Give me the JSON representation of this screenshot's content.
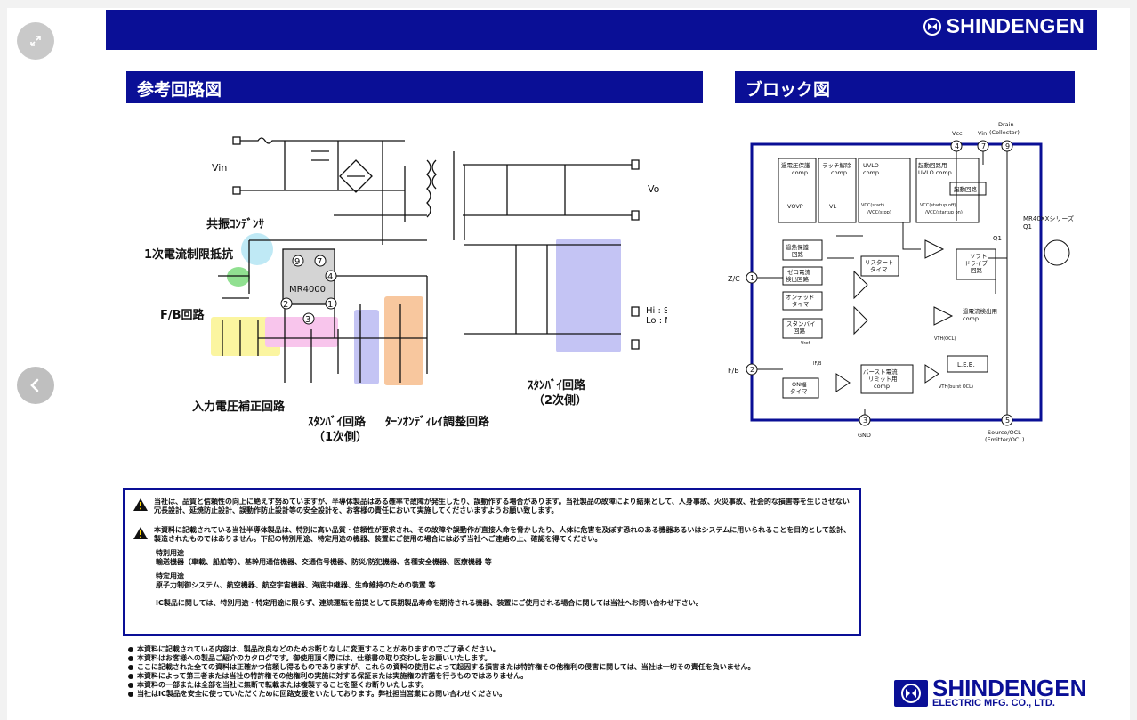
{
  "brand": {
    "top_logo": "SHINDENGEN",
    "foot_name": "SHINDENGEN",
    "foot_sub": "ELECTRIC MFG. CO., LTD."
  },
  "sections": {
    "circuit_title": "参考回路図",
    "block_title": "ブロック図"
  },
  "circuit": {
    "vin": "Vin",
    "vo": "Vo",
    "ic": "MR4000",
    "hi": "Hi : Stand-by",
    "lo": "Lo : Normal",
    "labels": {
      "resonant_cap": "共振ｺﾝﾃﾞﾝｻ",
      "primary_limit": "1次電流制限抵抗",
      "fb": "F/B回路",
      "input_comp": "入力電圧補正回路",
      "standby_1": "ｽﾀﾝﾊﾞｲ回路",
      "standby_1_sub": "（1次側）",
      "turn_on": "ﾀｰﾝｵﾝﾃﾞｨﾚｲ調整回路",
      "standby_2": "ｽﾀﾝﾊﾞｲ回路",
      "standby_2_sub": "（2次側）"
    },
    "pins": [
      "9",
      "7",
      "4",
      "2",
      "3",
      "1"
    ]
  },
  "block": {
    "vcc": "Vcc",
    "vin": "Vin",
    "drain": "Drain",
    "collector": "(Collector)",
    "series": "MR40XXシリーズ",
    "q1": "Q1",
    "zc": "Z/C",
    "fb": "F/B",
    "gnd": "GND",
    "source": "Source/OCL",
    "emitter": "(Emitter/OCL)",
    "pins": [
      "4",
      "7",
      "9",
      "1",
      "2",
      "3",
      "5"
    ],
    "comp_overvolt": "過電圧保護",
    "comp_overvolt2": "comp",
    "comp_latch": "ラッチ解除",
    "comp_latch2": "comp",
    "comp_uvlo": "UVLO",
    "comp_uvlo2": "comp",
    "comp_start": "起動回路用",
    "comp_start2": "UVLO comp",
    "start_circuit": "起動回路",
    "vcc_start": "VCC(start)",
    "vcc_stop": "/VCC(stop)",
    "vcc_start2": "VCC(startup off)",
    "vcc_stop2": "/VCC(startup on)",
    "vovp": "VOVP",
    "vl": "VL",
    "overheat": "過熱保護",
    "overheat2": "回路",
    "restart": "リスタート",
    "restart2": "タイマ",
    "soft": "ソフト",
    "soft2": "ドライブ",
    "soft3": "回路",
    "zero": "ゼロ電流",
    "zero2": "検出回路",
    "ondead": "オンデッド",
    "ondead2": "タイマ",
    "standby": "スタンバイ",
    "standby2": "回路",
    "ocp": "過電流検出用",
    "ocp2": "comp",
    "vth_ocl": "VTH(OCL)",
    "vref": "Vref",
    "ifb": "IF/B",
    "leb": "L.E.B.",
    "burst": "バースト電流",
    "burst2": "リミット用",
    "burst3": "comp",
    "vth_burst": "VTH(burst OCL)",
    "on_width": "ON幅",
    "on_width2": "タイマ"
  },
  "notice": {
    "p1": "当社は、品質と信頼性の向上に絶えず努めていますが、半導体製品はある確率で故障が発生したり、誤動作する場合があります。当社製品の故障により結果として、人身事故、火災事故、社会的な損害等を生じさせない冗長設計、延焼防止設計、誤動作防止設計等の安全設計を、お客様の責任において実施してくださいますようお願い致します。",
    "p2": "本資料に記載されている当社半導体製品は、特別に高い品質・信頼性が要求され、その故障や誤動作が直接人命を脅かしたり、人体に危害を及ぼす恐れのある機器あるいはシステムに用いられることを目的として設計、製造されたものではありません。下記の特別用途、特定用途の機器、装置にご使用の場合には必ず当社へご連絡の上、確認を得てください。",
    "special_title": "特別用途",
    "special_body": "輸送機器（車載、船舶等）、基幹用通信機器、交通信号機器、防災/防犯機器、各種安全機器、医療機器 等",
    "specific_title": "特定用途",
    "specific_body": "原子力制御システム、航空機器、航空宇宙機器、海底中継器、生命維持のための装置 等",
    "last": "IC製品に関しては、特別用途・特定用途に限らず、連続運転を前提として長期製品寿命を期待される機器、装置にご使用される場合に関しては当社へお問い合わせ下さい。"
  },
  "bullets": [
    "本資料に記載されている内容は、製品改良などのためお断りなしに変更することがありますのでご了承ください。",
    "本資料はお客様への製品ご紹介のカタログです。御使用頂く際には、仕様書の取り交わしをお願いいたします。",
    "ここに記載された全ての資料は正確かつ信頼し得るものでありますが、これらの資料の使用によって起因する損害または特許権その他権利の侵害に関しては、当社は一切その責任を負いません。",
    "本資料によって第三者または当社の特許権その他権利の実施に対する保証または実施権の許諾を行うものではありません。",
    "本資料の一部または全部を当社に無断で転載または複製することを堅くお断りいたします。",
    "当社はIC製品を安全に使っていただくために回路支援をいたしております。弊社担当営業にお問い合わせください。"
  ]
}
